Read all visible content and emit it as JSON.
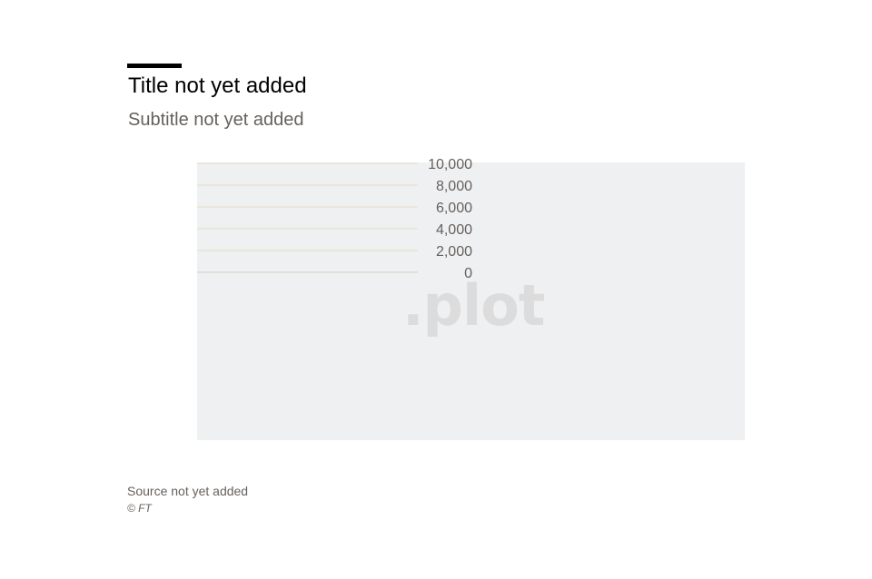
{
  "header": {
    "title": "Title not yet added",
    "subtitle": "Subtitle not yet added"
  },
  "footer": {
    "source": "Source not yet added",
    "copyright": "© FT"
  },
  "watermark": ".plot",
  "colors": {
    "plot_background": "#eff0f1",
    "gridline": "#e4dcc8",
    "tick_label": "#66605c",
    "watermark": "#dcdcdd"
  },
  "chart_data": {
    "type": "bar",
    "title": "Title not yet added",
    "subtitle": "Subtitle not yet added",
    "categories": [],
    "series": [],
    "yticks": [
      10000,
      8000,
      6000,
      4000,
      2000,
      0
    ],
    "ytick_labels": [
      "10,000",
      "8,000",
      "6,000",
      "4,000",
      "2,000",
      "0"
    ],
    "ylim": [
      0,
      10000
    ],
    "grid": true,
    "legend": "none"
  }
}
